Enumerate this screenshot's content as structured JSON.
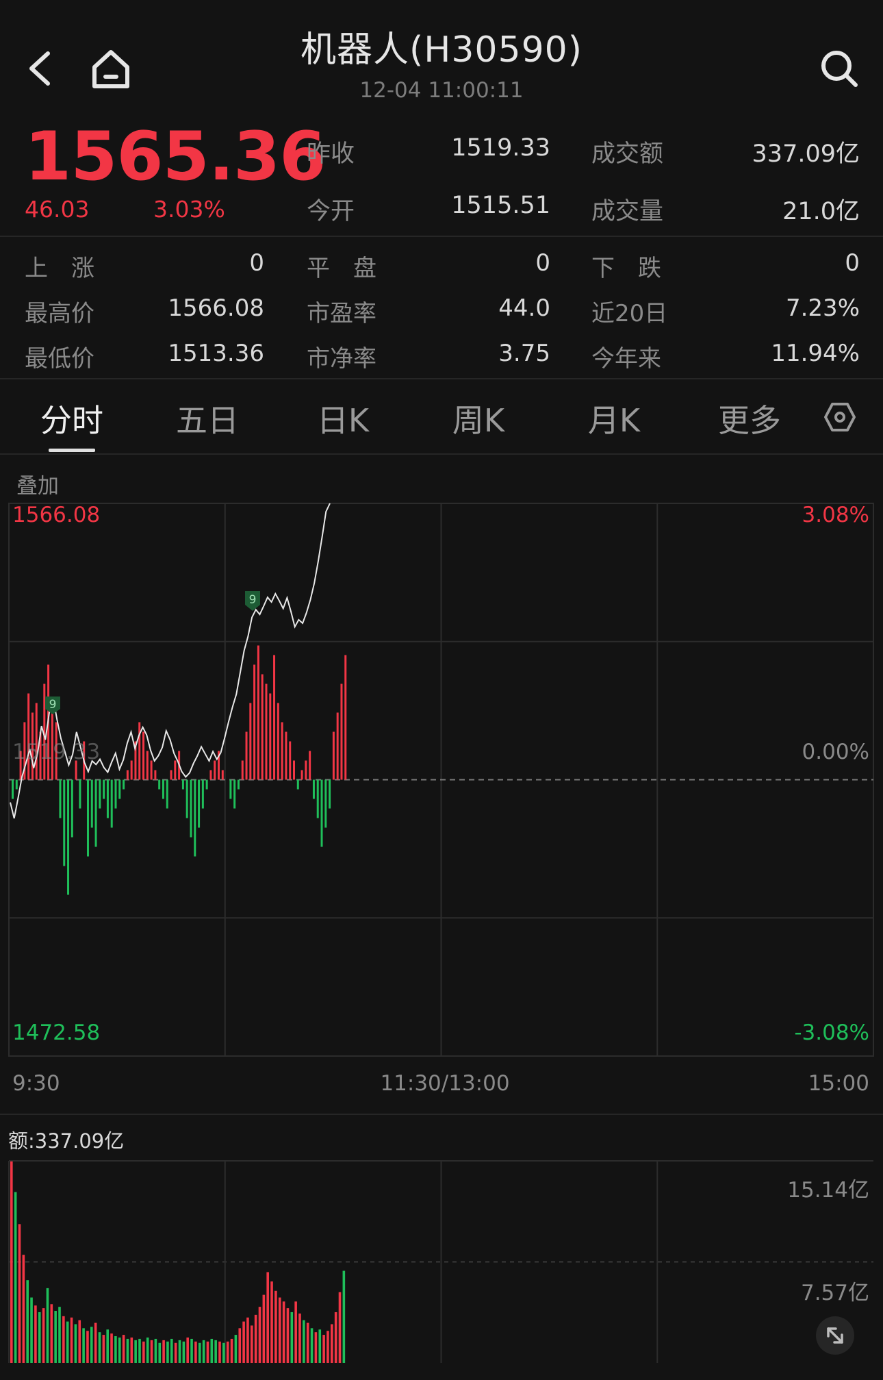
{
  "header": {
    "title": "机器人(H30590)",
    "timestamp": "12-04 11:00:11"
  },
  "quote": {
    "price": "1565.36",
    "change": "46.03",
    "change_pct": "3.03%",
    "color_up": "#f23645",
    "color_down": "#1fbf5a"
  },
  "quote_fields": [
    {
      "label": "昨收",
      "value": "1519.33"
    },
    {
      "label": "成交额",
      "value": "337.09亿"
    },
    {
      "label": "今开",
      "value": "1515.51"
    },
    {
      "label": "成交量",
      "value": "21.0亿"
    }
  ],
  "stats": [
    {
      "label": "上　涨",
      "value": "0"
    },
    {
      "label": "平　盘",
      "value": "0"
    },
    {
      "label": "下　跌",
      "value": "0"
    },
    {
      "label": "最高价",
      "value": "1566.08"
    },
    {
      "label": "市盈率",
      "value": "44.0"
    },
    {
      "label": "近20日",
      "value": "7.23%"
    },
    {
      "label": "最低价",
      "value": "1513.36"
    },
    {
      "label": "市净率",
      "value": "3.75"
    },
    {
      "label": "今年来",
      "value": "11.94%"
    }
  ],
  "tabs": [
    {
      "label": "分时",
      "active": true
    },
    {
      "label": "五日",
      "active": false
    },
    {
      "label": "日K",
      "active": false
    },
    {
      "label": "周K",
      "active": false
    },
    {
      "label": "月K",
      "active": false
    },
    {
      "label": "更多",
      "active": false
    }
  ],
  "overlay_label": "叠加",
  "chart_data": {
    "type": "line",
    "price_axis": {
      "top": "1566.08",
      "mid": "1519.33",
      "bottom": "1472.58"
    },
    "pct_axis": {
      "top": "3.08%",
      "mid": "0.00%",
      "bottom": "-3.08%"
    },
    "time_axis": [
      "9:30",
      "11:30/13:00",
      "15:00"
    ],
    "ylim": [
      1472.58,
      1566.08
    ],
    "prev_close": 1519.33,
    "minutes_total": 240,
    "price_series": [
      1515.5,
      1512.8,
      1516.2,
      1519.8,
      1522.1,
      1524.5,
      1521.3,
      1523.8,
      1528.4,
      1526.1,
      1530.7,
      1533.2,
      1529.5,
      1526.3,
      1524.1,
      1521.8,
      1523.6,
      1527.4,
      1524.9,
      1522.3,
      1520.7,
      1522.5,
      1521.9,
      1522.8,
      1521.4,
      1520.6,
      1522.3,
      1523.8,
      1521.1,
      1522.7,
      1525.5,
      1527.4,
      1524.6,
      1526.8,
      1528.2,
      1526.9,
      1524.3,
      1522.5,
      1523.4,
      1524.8,
      1527.6,
      1526.1,
      1523.8,
      1522.4,
      1520.7,
      1519.8,
      1520.5,
      1522.1,
      1523.4,
      1524.9,
      1523.7,
      1522.5,
      1524.1,
      1522.8,
      1523.9,
      1526.4,
      1529.1,
      1531.6,
      1533.8,
      1537.5,
      1541.2,
      1543.6,
      1546.8,
      1548.1,
      1547.3,
      1548.7,
      1550.2,
      1549.4,
      1550.8,
      1549.6,
      1548.3,
      1550.1,
      1547.8,
      1545.2,
      1546.4,
      1545.8,
      1547.6,
      1549.8,
      1552.6,
      1556.3,
      1560.4,
      1564.7,
      1566.08
    ],
    "momentum_bars": [
      -2,
      -1,
      3,
      6,
      9,
      7,
      8,
      5,
      10,
      12,
      8,
      6,
      -4,
      -9,
      -12,
      -6,
      2,
      -3,
      4,
      -8,
      -5,
      -7,
      -3,
      -2,
      -4,
      -5,
      -3,
      -2,
      -1,
      1,
      2,
      4,
      6,
      5,
      3,
      2,
      1,
      -1,
      -2,
      -3,
      1,
      2,
      3,
      -1,
      -4,
      -6,
      -8,
      -5,
      -3,
      -1,
      1,
      2,
      3,
      1,
      0,
      -2,
      -3,
      -1,
      2,
      5,
      8,
      12,
      14,
      11,
      10,
      9,
      13,
      8,
      6,
      5,
      4,
      2,
      -1,
      1,
      2,
      3,
      -2,
      -4,
      -7,
      -5,
      -3,
      5,
      7,
      10,
      13
    ]
  },
  "volume_chart": {
    "label": "额:337.09亿",
    "axis": {
      "top": "15.14亿",
      "mid": "7.57亿"
    },
    "ylim": [
      0,
      15.14
    ],
    "bars": [
      15.1,
      12.8,
      10.4,
      8.1,
      6.2,
      4.9,
      4.3,
      3.8,
      4.1,
      5.6,
      4.4,
      3.9,
      4.2,
      3.5,
      3.1,
      3.4,
      2.9,
      3.2,
      2.6,
      2.4,
      2.7,
      3.0,
      2.3,
      2.1,
      2.5,
      2.2,
      2.0,
      1.9,
      2.1,
      1.8,
      1.9,
      1.7,
      1.8,
      1.6,
      1.9,
      1.7,
      1.8,
      1.5,
      1.7,
      1.6,
      1.8,
      1.5,
      1.7,
      1.6,
      1.9,
      1.8,
      1.6,
      1.5,
      1.7,
      1.6,
      1.8,
      1.7,
      1.6,
      1.5,
      1.6,
      1.8,
      2.1,
      2.6,
      3.1,
      3.4,
      2.8,
      3.6,
      4.2,
      5.1,
      6.8,
      6.1,
      5.4,
      4.9,
      4.6,
      4.1,
      3.8,
      4.6,
      3.7,
      3.2,
      3.0,
      2.6,
      2.3,
      2.5,
      2.1,
      2.4,
      2.9,
      3.8,
      5.3,
      6.9
    ],
    "bar_up": [
      true,
      false,
      true,
      true,
      false,
      false,
      true,
      false,
      true,
      false,
      true,
      false,
      false,
      true,
      false,
      true,
      false,
      true,
      false,
      true,
      false,
      true,
      false,
      true,
      false,
      true,
      false,
      false,
      true,
      false,
      true,
      false,
      false,
      true,
      false,
      true,
      false,
      false,
      true,
      false,
      false,
      true,
      false,
      false,
      true,
      false,
      true,
      false,
      false,
      true,
      false,
      false,
      true,
      false,
      true,
      true,
      false,
      true,
      true,
      true,
      true,
      true,
      true,
      true,
      true,
      true,
      true,
      true,
      true,
      true,
      false,
      true,
      true,
      false,
      true,
      false,
      true,
      false,
      true,
      true,
      true,
      true,
      true,
      false
    ]
  }
}
